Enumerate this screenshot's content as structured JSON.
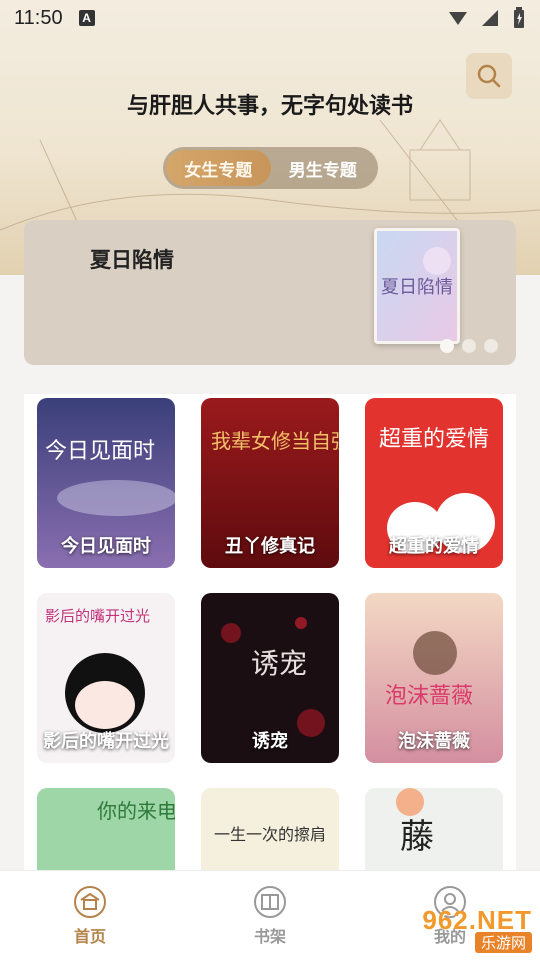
{
  "status": {
    "time": "11:50",
    "a_icon": "A"
  },
  "header": {
    "slogan": "与肝胆人共事，无字句处读书",
    "topics": [
      {
        "label": "女生专题",
        "active": true
      },
      {
        "label": "男生专题",
        "active": false
      }
    ]
  },
  "banner": {
    "title": "夏日陷情",
    "cover_text": "夏日陷情"
  },
  "books": [
    {
      "title": "今日见面时",
      "cover_text": "今日见面时"
    },
    {
      "title": "丑丫修真记",
      "cover_text": "我辈女修当自强"
    },
    {
      "title": "超重的爱情",
      "cover_text": "超重的爱情"
    },
    {
      "title": "影后的嘴开过光",
      "cover_text": "影后的嘴开过光"
    },
    {
      "title": "诱宠",
      "cover_text": "诱宠"
    },
    {
      "title": "泡沫蔷薇",
      "cover_text": "泡沫蔷薇"
    },
    {
      "title": "",
      "cover_text": "你的来电"
    },
    {
      "title": "",
      "cover_text": "一生一次的擦肩"
    },
    {
      "title": "",
      "cover_text": "藤"
    }
  ],
  "nav": [
    {
      "label": "首页",
      "icon": "home-icon",
      "active": true
    },
    {
      "label": "书架",
      "icon": "bookshelf-icon",
      "active": false
    },
    {
      "label": "我的",
      "icon": "profile-icon",
      "active": false
    }
  ],
  "watermark": {
    "top": "962.NET",
    "bottom": "乐游网"
  },
  "colors": {
    "accent": "#b4834a",
    "banner_bg": "#d9cfc2"
  }
}
